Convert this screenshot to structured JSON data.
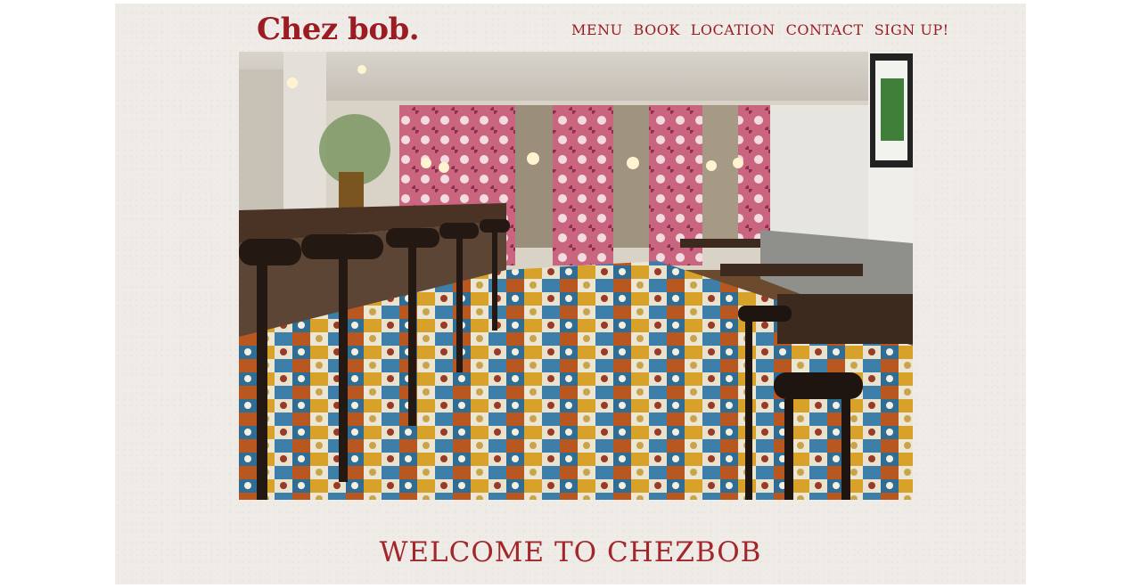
{
  "header": {
    "logo_text": "Chez bob.",
    "nav": [
      {
        "label": "MENU"
      },
      {
        "label": "BOOK"
      },
      {
        "label": "LOCATION"
      },
      {
        "label": "CONTACT"
      },
      {
        "label": "SIGN UP!"
      }
    ]
  },
  "hero": {
    "alt": "Restaurant interior with bar stools, wooden tables and colorful patterned tile floor"
  },
  "main": {
    "welcome_text": "WELCOME TO CHEZBOB"
  },
  "colors": {
    "brand_red": "#9b1c22",
    "paper": "#efece8"
  }
}
